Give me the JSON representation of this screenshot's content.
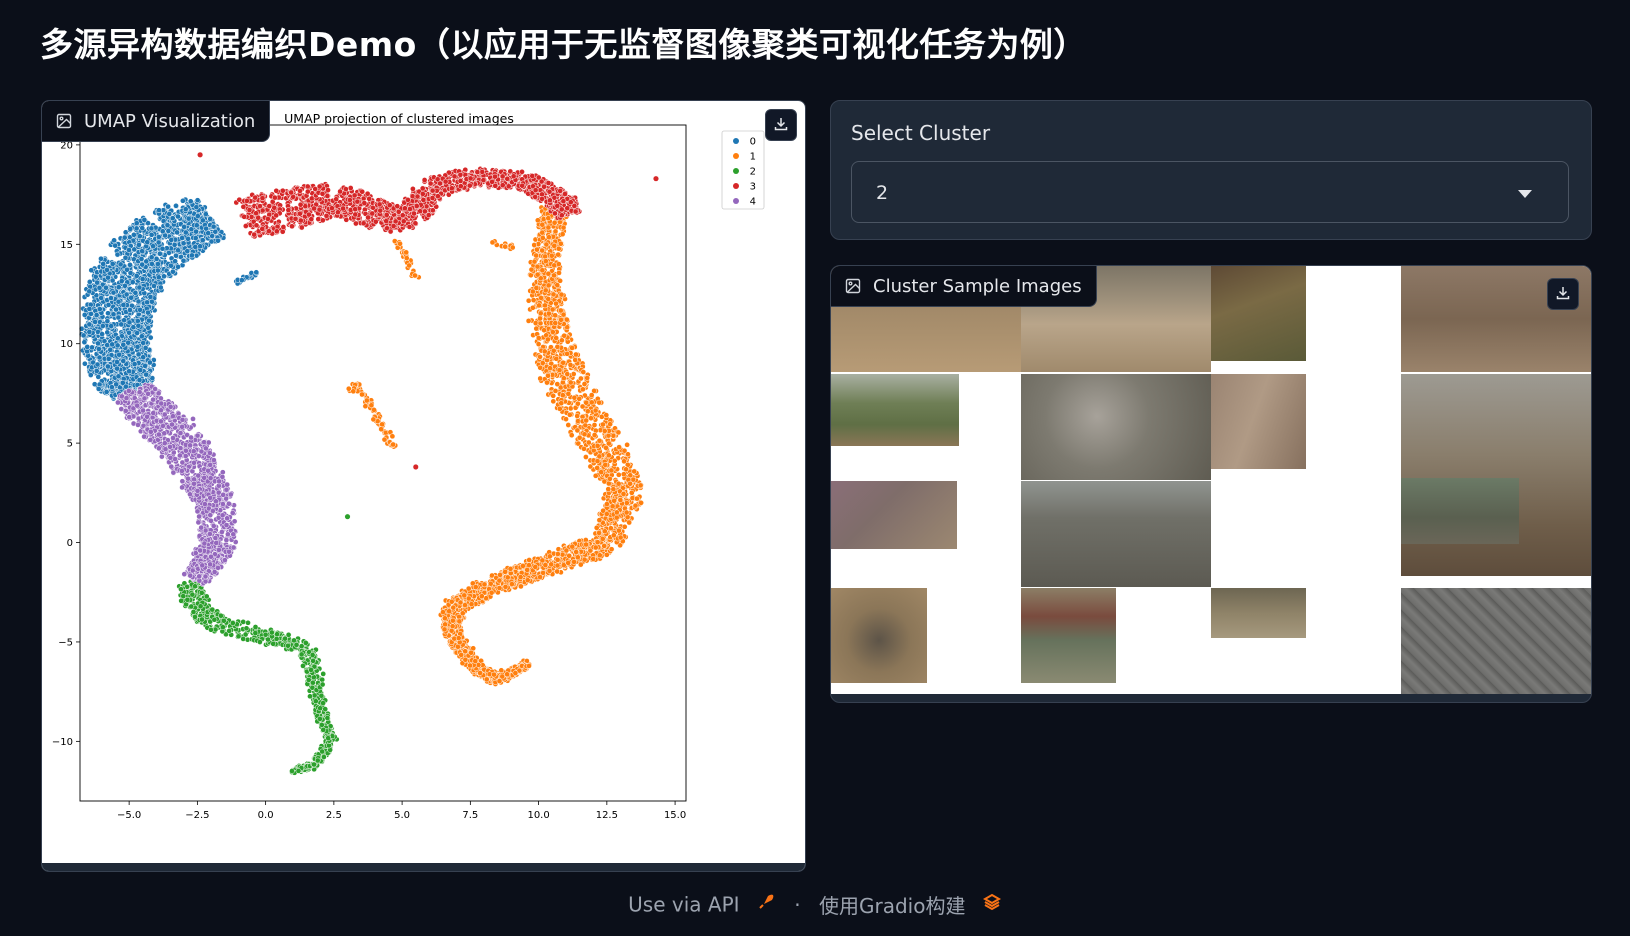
{
  "page_title": "多源异构数据编织Demo（以应用于无监督图像聚类可视化任务为例）",
  "umap_panel": {
    "label": "UMAP Visualization",
    "icon": "image-icon",
    "download_icon": "download-icon"
  },
  "select_panel": {
    "label": "Select Cluster",
    "value": "2",
    "caret_icon": "chevron-down-icon"
  },
  "gallery_panel": {
    "label": "Cluster Sample Images",
    "icon": "image-icon",
    "download_icon": "download-icon"
  },
  "footer": {
    "api_text": "Use via API",
    "api_icon": "rocket-icon",
    "separator": "·",
    "built_text": "使用Gradio构建",
    "gradio_icon": "gradio-logo-icon"
  },
  "chart_data": {
    "type": "scatter",
    "title": "UMAP projection of clustered images",
    "xlabel": "",
    "ylabel": "",
    "xlim": [
      -6.8,
      15.4
    ],
    "ylim": [
      -13,
      21
    ],
    "xticks": [
      -5.0,
      -2.5,
      0.0,
      2.5,
      5.0,
      7.5,
      10.0,
      12.5,
      15.0
    ],
    "xtick_labels": [
      "−5.0",
      "−2.5",
      "0.0",
      "2.5",
      "5.0",
      "7.5",
      "10.0",
      "12.5",
      "15.0"
    ],
    "yticks": [
      20,
      15,
      10,
      5,
      0,
      -5,
      -10
    ],
    "ytick_labels": [
      "20",
      "15",
      "10",
      "5",
      "0",
      "−5",
      "−10"
    ],
    "legend_position": "top-right",
    "grid": false,
    "series": [
      {
        "name": "0",
        "color": "#1f77b4",
        "path": [
          [
            -2,
            16.3
          ],
          [
            -3.5,
            15.5
          ],
          [
            -4.8,
            14
          ],
          [
            -5.4,
            12
          ],
          [
            -5.5,
            10
          ],
          [
            -5.3,
            8.5
          ],
          [
            -4.8,
            7.7
          ]
        ],
        "width": [
          2.2,
          2.8,
          2.6,
          2.5,
          2.4,
          2.3,
          1.5
        ]
      },
      {
        "name": "1",
        "color": "#ff7f0e",
        "path": [
          [
            10.6,
            16.8
          ],
          [
            10.2,
            14
          ],
          [
            10.4,
            11
          ],
          [
            11,
            8
          ],
          [
            12.3,
            5
          ],
          [
            13.2,
            2.5
          ],
          [
            12.5,
            0
          ],
          [
            10.2,
            -1.2
          ],
          [
            8.2,
            -2.2
          ],
          [
            6.9,
            -3.3
          ],
          [
            6.8,
            -4.5
          ],
          [
            7.7,
            -6.3
          ],
          [
            8.5,
            -6.9
          ],
          [
            9.6,
            -6.1
          ]
        ],
        "width": [
          0.9,
          1.0,
          1.3,
          1.6,
          1.6,
          1.3,
          1.1,
          1.0,
          0.9,
          0.8,
          0.6,
          0.5,
          0.4,
          0.3
        ]
      },
      {
        "name": "2",
        "color": "#2ca02c",
        "path": [
          [
            -2.8,
            -2
          ],
          [
            -2.5,
            -3.3
          ],
          [
            -1.5,
            -4.2
          ],
          [
            0.2,
            -4.8
          ],
          [
            1.5,
            -5.3
          ],
          [
            1.8,
            -6.8
          ],
          [
            2.0,
            -8.5
          ],
          [
            2.4,
            -10
          ],
          [
            1.8,
            -11.2
          ],
          [
            1.0,
            -11.5
          ]
        ],
        "width": [
          0.9,
          1.0,
          0.9,
          0.7,
          0.6,
          0.6,
          0.4,
          0.3,
          0.25,
          0.2
        ]
      },
      {
        "name": "3",
        "color": "#d62728",
        "path": [
          [
            -0.8,
            16.2
          ],
          [
            1.0,
            16.8
          ],
          [
            2.5,
            17.3
          ],
          [
            4.2,
            16.4
          ],
          [
            5.5,
            16.5
          ],
          [
            6.0,
            17.8
          ],
          [
            7.5,
            18.4
          ],
          [
            9.5,
            18.2
          ],
          [
            10.8,
            17.2
          ],
          [
            11.1,
            16.5
          ]
        ],
        "width": [
          2.0,
          2.0,
          1.6,
          1.4,
          1.2,
          1.0,
          0.9,
          0.9,
          1.0,
          0.8
        ]
      },
      {
        "name": "4",
        "color": "#9467bd",
        "path": [
          [
            -4.8,
            7.7
          ],
          [
            -4.2,
            6.5
          ],
          [
            -3.2,
            5.3
          ],
          [
            -2.5,
            3.5
          ],
          [
            -1.8,
            2
          ],
          [
            -1.7,
            0
          ],
          [
            -2.2,
            -1.2
          ],
          [
            -2.6,
            -1.8
          ]
        ],
        "width": [
          1.4,
          1.8,
          1.7,
          1.6,
          1.4,
          1.3,
          1.0,
          0.8
        ]
      }
    ],
    "outliers": [
      {
        "x": -2.4,
        "y": 19.5,
        "series": "3"
      },
      {
        "x": 14.3,
        "y": 18.3,
        "series": "3"
      },
      {
        "x": 5.5,
        "y": 3.8,
        "series": "3"
      },
      {
        "x": 3.0,
        "y": 1.3,
        "series": "2"
      }
    ],
    "small_strands": [
      {
        "series": "1",
        "path": [
          [
            3.3,
            8
          ],
          [
            3.8,
            7
          ],
          [
            4.2,
            6
          ],
          [
            4.7,
            4.8
          ]
        ],
        "width": 0.22
      },
      {
        "series": "1",
        "path": [
          [
            3.0,
            7.8
          ],
          [
            3.3,
            7.6
          ]
        ],
        "width": 0.15
      },
      {
        "series": "1",
        "path": [
          [
            4.8,
            15.2
          ],
          [
            5.2,
            14.2
          ],
          [
            5.5,
            13.3
          ]
        ],
        "width": 0.18
      },
      {
        "series": "1",
        "path": [
          [
            8.3,
            15.1
          ],
          [
            9.1,
            14.9
          ]
        ],
        "width": 0.15
      },
      {
        "series": "0",
        "path": [
          [
            -1.2,
            13
          ],
          [
            -0.3,
            13.6
          ]
        ],
        "width": 0.18
      }
    ]
  }
}
